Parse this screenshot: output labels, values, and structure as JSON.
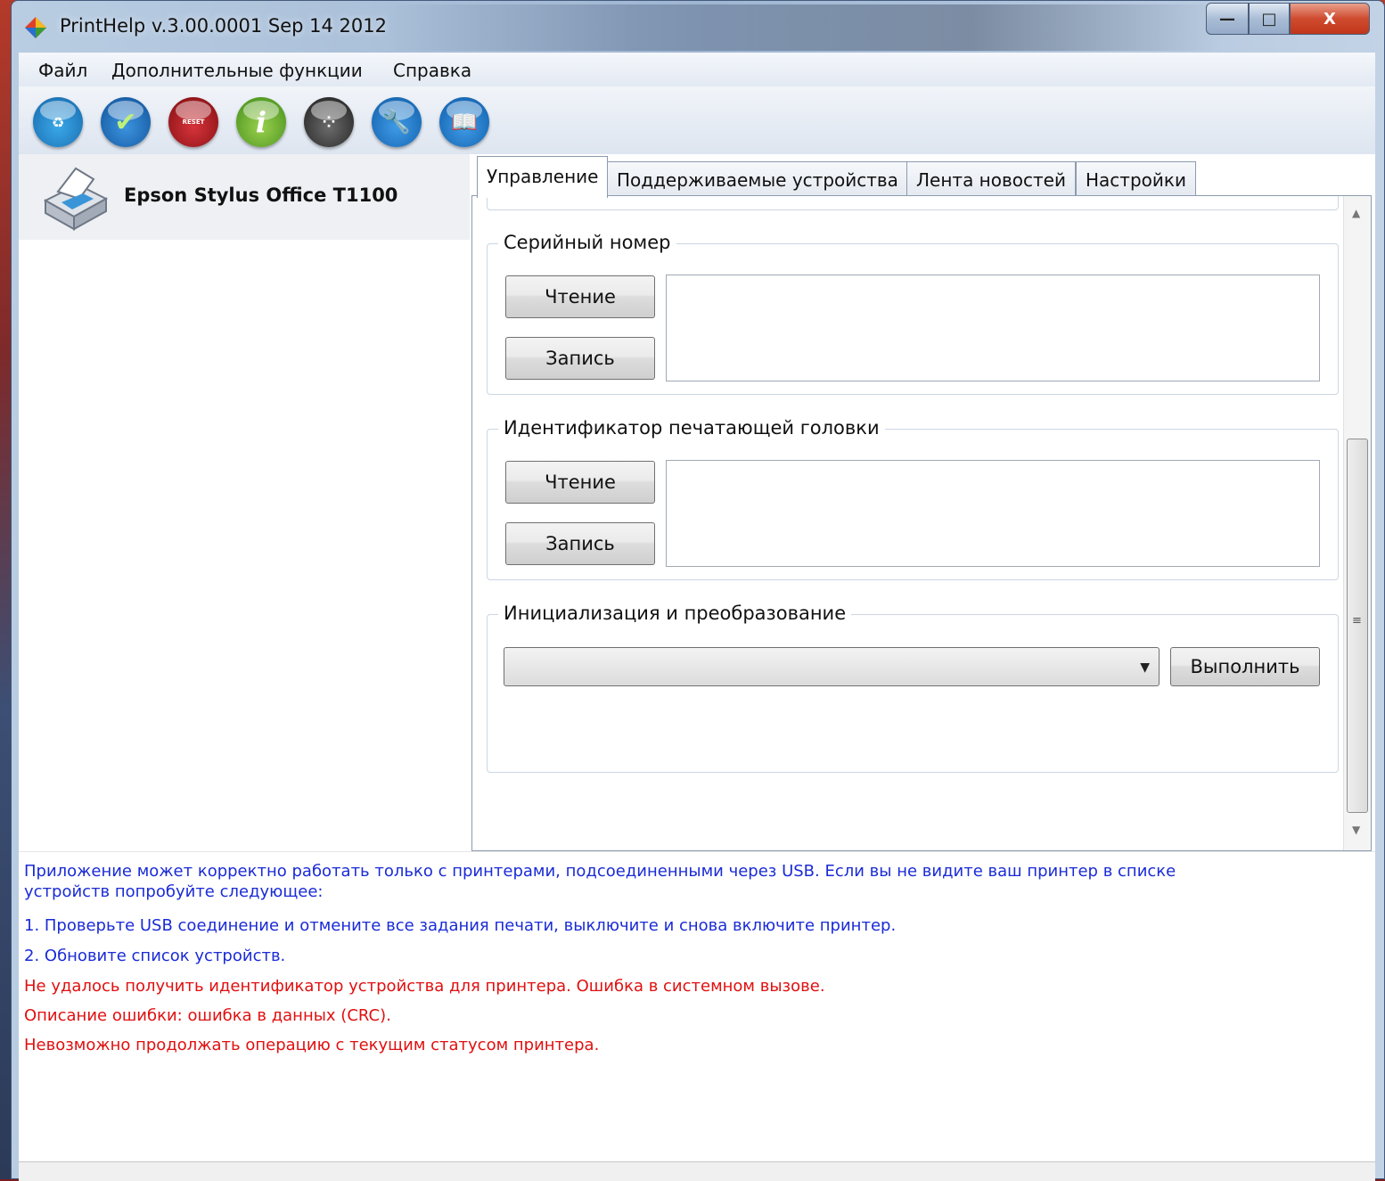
{
  "window": {
    "title": "PrintHelp v.3.00.0001 Sep 14 2012",
    "controls": {
      "minimize": "—",
      "maximize": "□",
      "close": "X"
    }
  },
  "menu": [
    "Файл",
    "Дополнительные функции",
    "Справка"
  ],
  "toolbar": [
    {
      "name": "refresh-icon",
      "color": "#2e86c9"
    },
    {
      "name": "check-icon",
      "color": "#1f6fb8"
    },
    {
      "name": "reset-icon",
      "color": "#b01c1c",
      "label": "RESET"
    },
    {
      "name": "info-icon",
      "color": "#6bb33b"
    },
    {
      "name": "ink-icon",
      "color": "#3a3a3a"
    },
    {
      "name": "wrench-icon",
      "color": "#1b77c6"
    },
    {
      "name": "book-icon",
      "color": "#1b77c6"
    }
  ],
  "device": {
    "name": "Epson Stylus Office T1100"
  },
  "tabs": [
    {
      "label": "Управление",
      "active": true
    },
    {
      "label": "Поддерживаемые устройства",
      "active": false
    },
    {
      "label": "Лента новостей",
      "active": false
    },
    {
      "label": "Настройки",
      "active": false
    }
  ],
  "groups": {
    "serial": {
      "title": "Серийный номер",
      "read": "Чтение",
      "write": "Запись",
      "value": ""
    },
    "head": {
      "title": "Идентификатор печатающей головки",
      "read": "Чтение",
      "write": "Запись",
      "value": ""
    },
    "init": {
      "title": "Инициализация и преобразование",
      "selected": "",
      "execute": "Выполнить"
    }
  },
  "log": {
    "info_line1": "Приложение может корректно работать только с принтерами, подсоединенными через USB. Если вы не видите ваш принтер в списке",
    "info_line2": "устройств попробуйте следующее:",
    "step1": "1. Проверьте USB соединение и отмените все задания печати, выключите и снова включите принтер.",
    "step2": "2. Обновите список устройств.",
    "error1": "Не удалось получить идентификатор устройства для принтера. Ошибка в системном вызове.",
    "error2": "Описание ошибки: ошибка в данных (CRC).",
    "error3": "Невозможно продолжать операцию с текущим статусом принтера.",
    "info_color": "#1a2bd6",
    "error_color": "#e01010"
  }
}
